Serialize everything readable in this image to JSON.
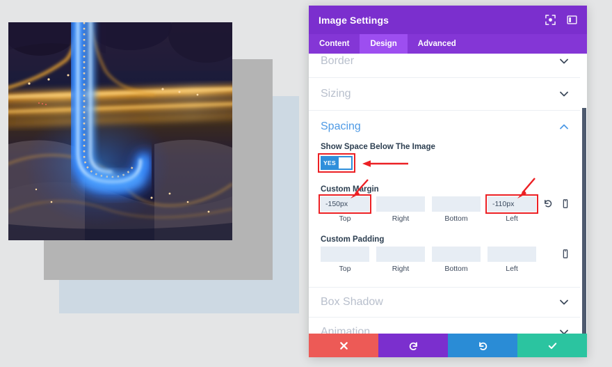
{
  "canvas": {
    "photo_alt": "aerial night photo of highway interchange with blue and orange light trails",
    "shapes": [
      {
        "name": "blue-rectangle",
        "color": "#cdd9e3"
      },
      {
        "name": "gray-rectangle",
        "color": "#b4b4b4"
      }
    ],
    "background_color": "#e4e5e6"
  },
  "modal": {
    "title": "Image Settings",
    "header_icons": [
      {
        "name": "focus-target-icon"
      },
      {
        "name": "panel-layout-icon"
      }
    ],
    "tabs": [
      {
        "label": "Content",
        "active": false
      },
      {
        "label": "Design",
        "active": true
      },
      {
        "label": "Advanced",
        "active": false
      }
    ],
    "sections": [
      {
        "label": "Border",
        "open": false
      },
      {
        "label": "Sizing",
        "open": false
      },
      {
        "label": "Spacing",
        "open": true
      },
      {
        "label": "Box Shadow",
        "open": false
      },
      {
        "label": "Animation",
        "open": false
      }
    ],
    "spacing": {
      "toggle_label": "Show Space Below The Image",
      "toggle_value": "YES",
      "margin_label": "Custom Margin",
      "margin": [
        {
          "caption": "Top",
          "value": "-150px",
          "highlighted": true
        },
        {
          "caption": "Right",
          "value": "",
          "highlighted": false
        },
        {
          "caption": "Bottom",
          "value": "",
          "highlighted": false
        },
        {
          "caption": "Left",
          "value": "-110px",
          "highlighted": true
        }
      ],
      "margin_tools": [
        {
          "name": "reset-icon"
        },
        {
          "name": "responsive-device-icon"
        }
      ],
      "padding_label": "Custom Padding",
      "padding": [
        {
          "caption": "Top",
          "value": ""
        },
        {
          "caption": "Right",
          "value": ""
        },
        {
          "caption": "Bottom",
          "value": ""
        },
        {
          "caption": "Left",
          "value": ""
        }
      ],
      "padding_tools": [
        {
          "name": "responsive-device-icon"
        }
      ]
    },
    "footer_buttons": [
      {
        "name": "cancel-button",
        "icon": "close-icon",
        "color": "#ed5a56"
      },
      {
        "name": "undo-button",
        "icon": "undo-icon",
        "color": "#7b2fce"
      },
      {
        "name": "redo-button",
        "icon": "redo-icon",
        "color": "#2a8cd6"
      },
      {
        "name": "save-button",
        "icon": "check-icon",
        "color": "#2bc4a0"
      }
    ]
  },
  "annotations": {
    "highlight_color": "#ec2024",
    "items": [
      {
        "name": "toggle-highlight"
      },
      {
        "name": "margin-top-highlight"
      },
      {
        "name": "margin-left-highlight"
      }
    ]
  }
}
